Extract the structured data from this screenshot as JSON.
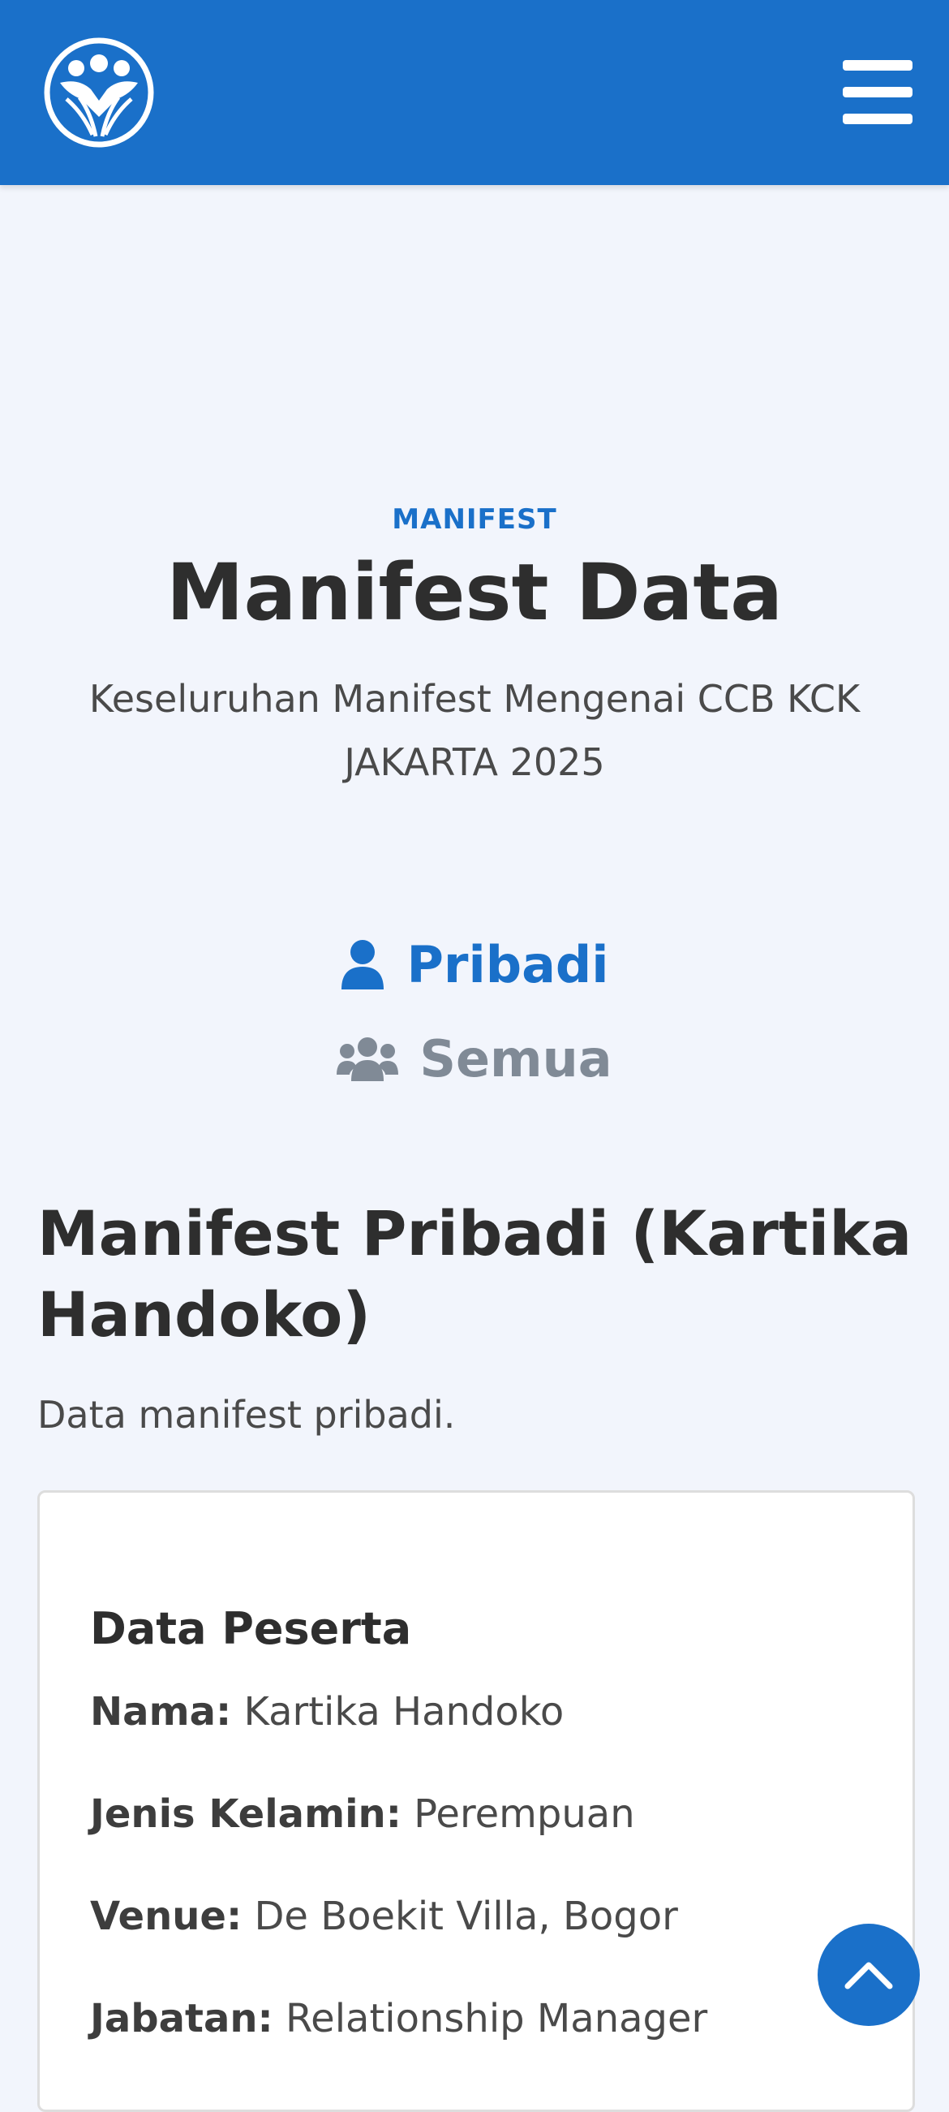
{
  "header": {
    "logo_icon": "people-circle-logo-icon",
    "menu_icon": "hamburger-menu-icon",
    "bg_color": "#1a70c9"
  },
  "hero": {
    "eyebrow": "MANIFEST",
    "title": "Manifest Data",
    "subtitle": "Keseluruhan Manifest Mengenai CCB KCK JAKARTA 2025"
  },
  "tabs": [
    {
      "label": "Pribadi",
      "icon": "user-icon",
      "active": true
    },
    {
      "label": "Semua",
      "icon": "users-icon",
      "active": false
    }
  ],
  "section": {
    "title": "Manifest Pribadi (Kartika Handoko)",
    "description": "Data manifest pribadi."
  },
  "card": {
    "title": "Data Peserta",
    "fields": [
      {
        "key": "Nama:",
        "value": "Kartika Handoko"
      },
      {
        "key": "Jenis Kelamin:",
        "value": "Perempuan"
      },
      {
        "key": "Venue:",
        "value": "De Boekit Villa, Bogor"
      },
      {
        "key": "Jabatan:",
        "value": "Relationship Manager"
      }
    ]
  },
  "scroll_top": {
    "icon": "chevron-up-icon"
  }
}
